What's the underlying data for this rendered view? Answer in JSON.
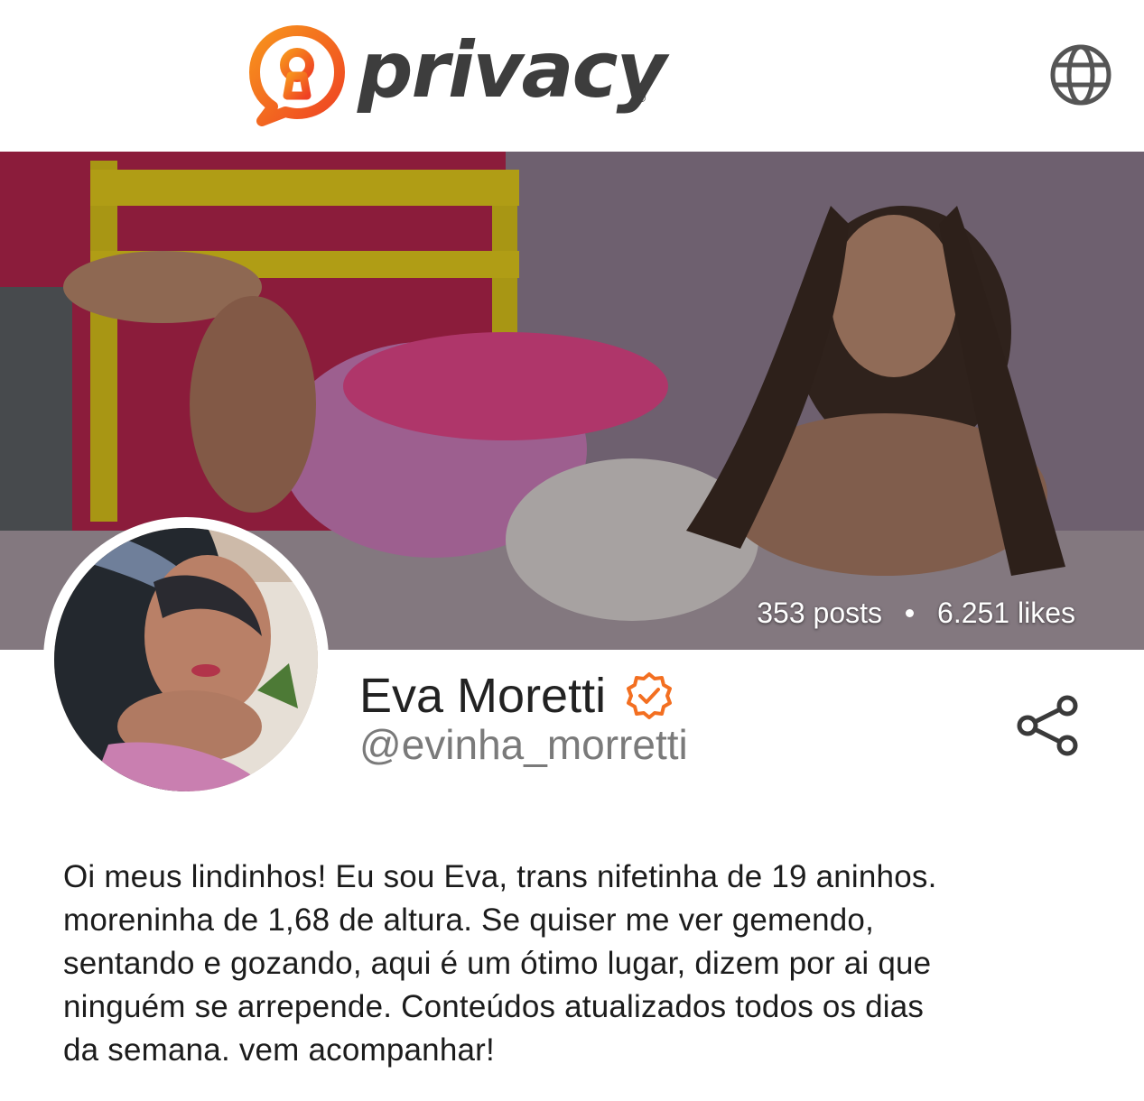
{
  "brand": {
    "name": "privacy",
    "accent": "#f36f21",
    "registered": "®"
  },
  "header": {
    "language_icon": "globe-icon"
  },
  "profile": {
    "posts": "353 posts",
    "likes": "6.251 likes",
    "display_name": "Eva Moretti",
    "handle": "@evinha_morretti",
    "verified_icon": "verified-badge-icon",
    "share_icon": "share-icon",
    "bio": "Oi meus lindinhos! Eu sou Eva, trans nifetinha de 19 aninhos.\nmoreninha de 1,68 de altura. Se quiser me ver gemendo,\nsentando e gozando, aqui é um ótimo lugar, dizem por ai que\nninguém se arrepende. Conteúdos atualizados todos os dias\nda semana. vem acompanhar!"
  }
}
